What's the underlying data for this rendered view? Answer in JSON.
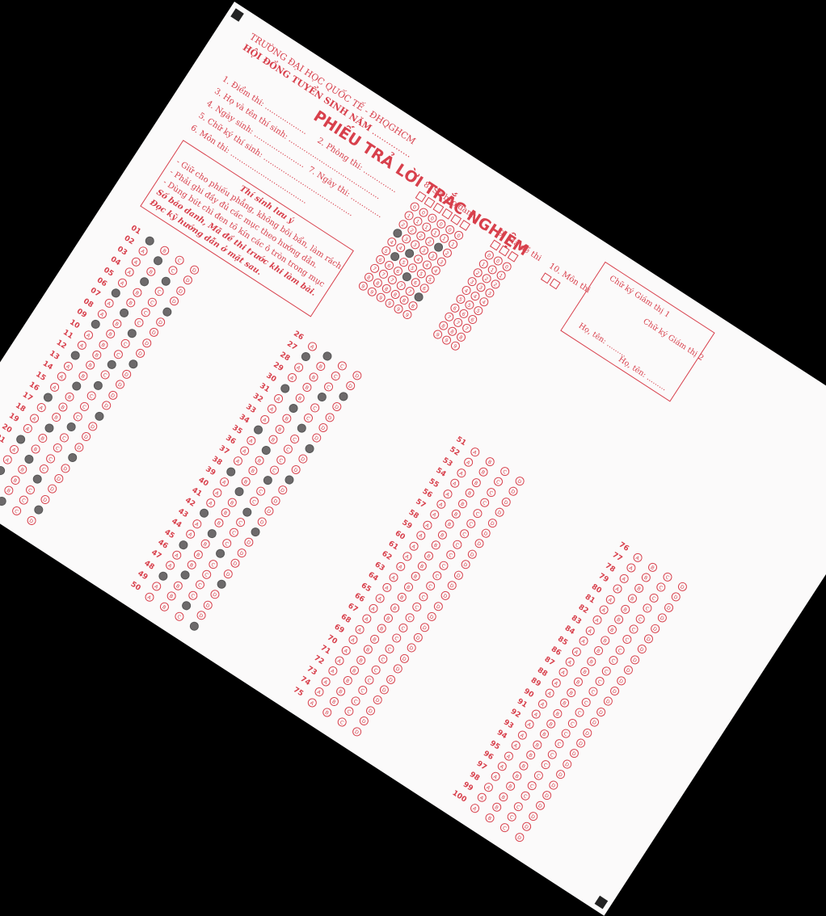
{
  "header": {
    "school": "TRƯỜNG ĐẠI HỌC QUỐC TẾ - ĐHQGHCM",
    "council": "HỘI ĐỒNG TUYỂN SINH NĂM"
  },
  "title": "PHIẾU TRẢ LỜI TRẮC NGHIỆM",
  "fields": {
    "f1": "1. Điểm thi:",
    "f2": "2. Phòng thi:",
    "f3": "3. Họ và tên thí sinh:",
    "f4": "4. Ngày sinh:",
    "f5": "5. Chữ ký thí sinh:",
    "f6": "6. Môn thi:",
    "f7": "7. Ngày thi:",
    "f8": "8. Số báo danh",
    "f9": "9. Mã đề thi",
    "f10": "10. Môn thi"
  },
  "notice": {
    "title": "Thí sinh lưu ý",
    "l1": "- Giữ cho phiếu phẳng, không bôi bẩn, làm rách.",
    "l2": "- Phải ghi đầy đủ các mục theo hướng dẫn.",
    "l3": "- Dùng bút chì đen tô kín các ô tròn trong mục",
    "l4": "Số báo danh, Mã đề thi trước khi làm bài.",
    "l5": "Đọc kỹ hướng dẫn ở mặt sau."
  },
  "signatures": {
    "sup1": "Chữ ký Giám thị 1",
    "sup2": "Chữ ký Giám thị 2",
    "name1": "Họ, tên:",
    "name2": "Họ, tên:"
  },
  "options": [
    "A",
    "B",
    "C",
    "D"
  ],
  "digits": [
    "0",
    "1",
    "2",
    "3",
    "4",
    "5",
    "6",
    "7",
    "8",
    "9"
  ],
  "answers": {
    "1": "A",
    "2": "B",
    "3": "C",
    "4": "B",
    "5": "D",
    "6": "A",
    "7": "B",
    "8": "C",
    "9": "A",
    "10": "D",
    "11": "C",
    "12": "A",
    "13": "C",
    "14": "B",
    "15": "D",
    "16": "A",
    "17": "C",
    "18": "B",
    "19": "D",
    "20": "A",
    "21": "B",
    "22": "C",
    "23": "A",
    "24": "D",
    "25": "B",
    "26": "B",
    "27": "A",
    "28": "D",
    "29": "C",
    "30": "A",
    "31": "B",
    "32": "C",
    "33": "D",
    "34": "A",
    "35": "B",
    "36": "D",
    "37": "C",
    "38": "A",
    "39": "B",
    "40": "C",
    "41": "D",
    "42": "A",
    "43": "B",
    "44": "C",
    "45": "A",
    "46": "D",
    "47": "B",
    "48": "A",
    "49": "C",
    "50": "D"
  },
  "sbd_marks": [
    3,
    5,
    4,
    6,
    2,
    7
  ],
  "colors": {
    "ink": "#d8404c",
    "fill": "#6d6a6b",
    "paper": "#fbfafa"
  }
}
